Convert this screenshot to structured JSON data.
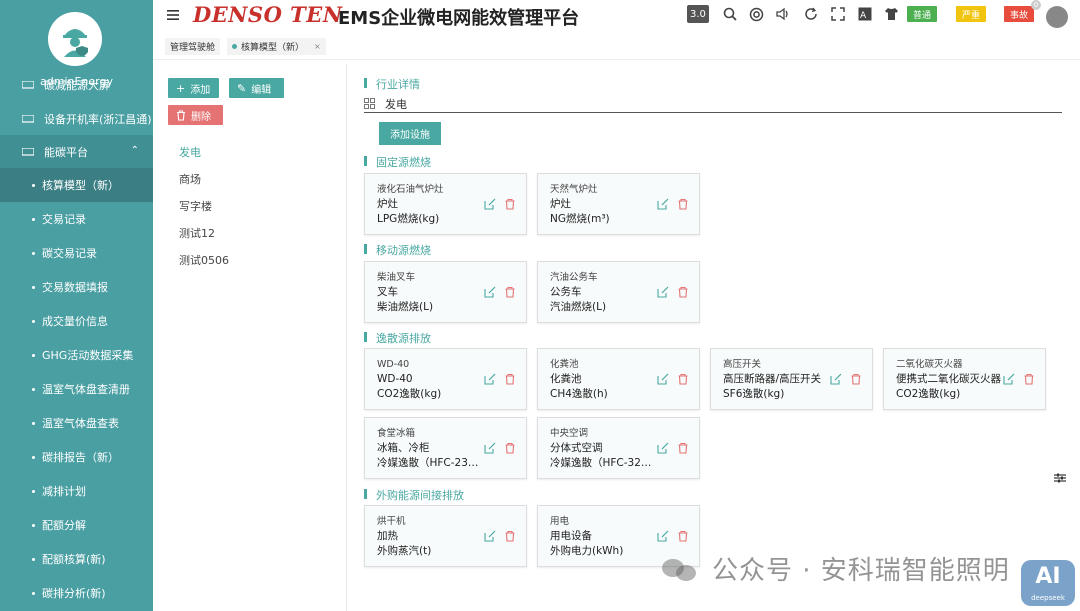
{
  "sidebar": {
    "username": "adminEnergy",
    "items": [
      {
        "label": "碳减能源大屏",
        "type": "item"
      },
      {
        "label": "设备开机率(浙江昌通)",
        "type": "item"
      },
      {
        "label": "能碳平台",
        "type": "group"
      },
      {
        "label": "核算模型（新）",
        "type": "sub",
        "active": true
      },
      {
        "label": "交易记录",
        "type": "sub"
      },
      {
        "label": "碳交易记录",
        "type": "sub"
      },
      {
        "label": "交易数据填报",
        "type": "sub"
      },
      {
        "label": "成交量价信息",
        "type": "sub"
      },
      {
        "label": "GHG活动数据采集",
        "type": "sub"
      },
      {
        "label": "温室气体盘查清册",
        "type": "sub"
      },
      {
        "label": "温室气体盘查表",
        "type": "sub"
      },
      {
        "label": "碳排报告（新）",
        "type": "sub"
      },
      {
        "label": "减排计划",
        "type": "sub"
      },
      {
        "label": "配额分解",
        "type": "sub"
      },
      {
        "label": "配额核算(新)",
        "type": "sub"
      },
      {
        "label": "碳排分析(新)",
        "type": "sub"
      }
    ]
  },
  "header": {
    "brand": "DENSO TEN",
    "title": "EMS企业微电网能效管理平台",
    "version": "3.0",
    "levels": [
      "普通",
      "严重",
      "事故"
    ],
    "notif_count": "0"
  },
  "tabs": [
    {
      "label": "管理驾驶舱"
    },
    {
      "label": "核算模型（新）",
      "close": "×"
    }
  ],
  "left_panel": {
    "add_label": "添加",
    "edit_label": "编辑",
    "delete_label": "删除",
    "industries": [
      "发电",
      "商场",
      "写字楼",
      "测试12",
      "测试0506"
    ]
  },
  "content": {
    "industry_section": "行业详情",
    "industry_name": "发电",
    "add_facility_label": "添加设施",
    "sections": [
      {
        "title": "固定源燃烧",
        "cards": [
          {
            "name": "液化石油气炉灶",
            "line1": "炉灶",
            "line2": "LPG燃烧(kg)"
          },
          {
            "name": "天然气炉灶",
            "line1": "炉灶",
            "line2": "NG燃烧(m³)"
          }
        ]
      },
      {
        "title": "移动源燃烧",
        "cards": [
          {
            "name": "柴油叉车",
            "line1": "叉车",
            "line2": "柴油燃烧(L)"
          },
          {
            "name": "汽油公务车",
            "line1": "公务车",
            "line2": "汽油燃烧(L)"
          }
        ]
      },
      {
        "title": "逸散源排放",
        "cards": [
          {
            "name": "WD-40",
            "line1": "WD-40",
            "line2": "CO2逸散(kg)"
          },
          {
            "name": "化粪池",
            "line1": "化粪池",
            "line2": "CH4逸散(h)"
          },
          {
            "name": "高压开关",
            "line1": "高压断路器/高压开关",
            "line2": "SF6逸散(kg)"
          },
          {
            "name": "二氧化碳灭火器",
            "line1": "便携式二氧化碳灭火器",
            "line2": "CO2逸散(kg)"
          },
          {
            "name": "食堂冰箱",
            "line1": "冰箱、冷柜",
            "line2": "冷媒逸散（HFC-23…"
          },
          {
            "name": "中央空调",
            "line1": "分体式空调",
            "line2": "冷媒逸散（HFC-32…"
          }
        ]
      },
      {
        "title": "外购能源间接排放",
        "cards": [
          {
            "name": "烘干机",
            "line1": "加热",
            "line2": "外购蒸汽(t)"
          },
          {
            "name": "用电",
            "line1": "用电设备",
            "line2": "外购电力(kWh)"
          }
        ]
      }
    ]
  },
  "watermark": {
    "text": "公众号 · 安科瑞智能照明",
    "ai_text": "AI",
    "ai_sub": "deepseek"
  }
}
